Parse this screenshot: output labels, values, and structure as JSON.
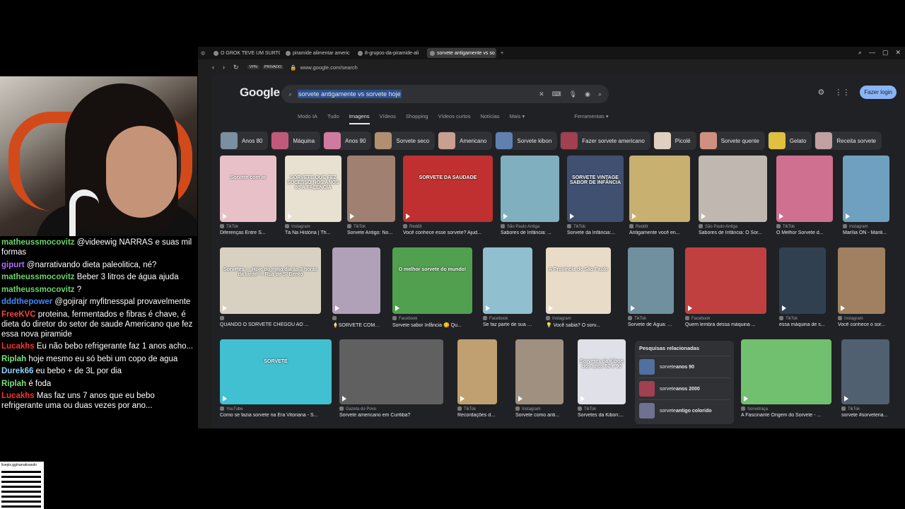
{
  "chat": {
    "messages": [
      {
        "user": "matheussmocovitz",
        "color": "#6ad46a",
        "text": "@videewig NARRAS e suas mil formas"
      },
      {
        "user": "gipurt",
        "color": "#b36bff",
        "text": "@narrativando dieta paleolitica, né?"
      },
      {
        "user": "matheussmocovitz",
        "color": "#6ad46a",
        "text": "Beber 3 litros de água ajuda"
      },
      {
        "user": "matheussmocovitz",
        "color": "#6ad46a",
        "text": "?"
      },
      {
        "user": "dddthepower",
        "color": "#3b8bff",
        "text": "@gojirajr myfitnesspal provavelmente"
      },
      {
        "user": "FreeKVC",
        "color": "#ff4040",
        "text": "proteina, fermentados e fibras é chave, é dieta do diretor do setor de saude Americano que fez essa nova piramide"
      },
      {
        "user": "Lucakhs",
        "color": "#ff3030",
        "text": "Eu não bebo refrigerante faz 1 anos acho..."
      },
      {
        "user": "Riplah",
        "color": "#7ee07e",
        "text": "hoje mesmo eu só bebi um copo de agua"
      },
      {
        "user": "Durek66",
        "color": "#8fd3ff",
        "text": "eu bebo + de 3L por dia"
      },
      {
        "user": "Riplah",
        "color": "#7ee07e",
        "text": "é foda"
      },
      {
        "user": "Lucakhs",
        "color": "#ff3030",
        "text": "Mas faz uns 7 anos que eu bebo refrigerante uma ou duas vezes por ano..."
      }
    ]
  },
  "qr": {
    "url": "livepix.gg/narrativando"
  },
  "browser": {
    "tabs": [
      {
        "label": "O GROK TEVE UM SURTO",
        "active": false
      },
      {
        "label": "piramide alimentar americ",
        "active": false
      },
      {
        "label": "8-grupos-da-piramide-ali",
        "active": false
      },
      {
        "label": "sorvete antigamente vs so",
        "active": true
      }
    ],
    "url": "www.google.com/search",
    "vpn": "VPN",
    "private": "PRIVADO"
  },
  "google": {
    "logo": "Google",
    "query": "sorvete antigamente vs sorvete hoje",
    "login": "Fazer login",
    "tabs": [
      "Modo IA",
      "Tudo",
      "Imagens",
      "Vídeos",
      "Shopping",
      "Vídeos curtos",
      "Notícias",
      "Mais ▾",
      "Ferramentas ▾"
    ],
    "chips": [
      {
        "label": "Anos 80",
        "color": "#7a8fa0"
      },
      {
        "label": "Máquina",
        "color": "#c05a7a"
      },
      {
        "label": "Anos 90",
        "color": "#d07aa0"
      },
      {
        "label": "Sorvete seco",
        "color": "#b09070"
      },
      {
        "label": "Americano",
        "color": "#c8a090"
      },
      {
        "label": "Sorvete kibon",
        "color": "#6080b0"
      },
      {
        "label": "Fazer sorvete americano",
        "color": "#a04050"
      },
      {
        "label": "Picolé",
        "color": "#e0d0c0"
      },
      {
        "label": "Sorvete quente",
        "color": "#d09080"
      },
      {
        "label": "Gelato",
        "color": "#e0c040"
      },
      {
        "label": "Receita sorvete",
        "color": "#c0a0a0"
      }
    ],
    "row1": [
      {
        "src": "TikTok",
        "title": "Diferenças Entre S...",
        "color": "#e8c0c8",
        "overlay": "Sorvete com ar"
      },
      {
        "src": "Instagram",
        "title": "Tá Na História | Th...",
        "color": "#e8e0d0",
        "overlay": "SORVETE QUE FEZ SUCESSO NOS ANOS 80 À FALÊNCIA"
      },
      {
        "src": "TikTok",
        "title": "Sorvete Antigo: No...",
        "color": "#a08070",
        "overlay": ""
      },
      {
        "src": "Reddit",
        "title": "Você conhece esse sorvete? Ajud...",
        "color": "#c03030",
        "overlay": "SORVETE DA SAUDADE"
      },
      {
        "src": "São Paulo Antiga",
        "title": "Sabores de Infância: ...",
        "color": "#80b0c0",
        "overlay": ""
      },
      {
        "src": "TikTok",
        "title": "Sorvete da Infância:...",
        "color": "#405070",
        "overlay": "SORVETE VINTAGE SABOR DE INFÂNCIA"
      },
      {
        "src": "Reddit",
        "title": "Antigamente você en...",
        "color": "#c8b070",
        "overlay": ""
      },
      {
        "src": "São Paulo Antiga",
        "title": "Sabores de Infância: O Sor...",
        "color": "#c0b8b0",
        "overlay": ""
      },
      {
        "src": "TikTok",
        "title": "O Melhor Sorvete d...",
        "color": "#d07090",
        "overlay": ""
      },
      {
        "src": "Instagram",
        "title": "Marília ON - Marili...",
        "color": "#70a0c0",
        "overlay": ""
      }
    ],
    "row2": [
      {
        "src": "",
        "title": "QUANDO O SORVETE CHEGOU AO ...",
        "color": "#d8d0c0",
        "overlay": "Sorvetes — Hoje do meio dia às 3 horas da tarde — Rua de S. Bento"
      },
      {
        "src": "",
        "title": "🍦SORVETE COM ...",
        "color": "#b0a0b8",
        "overlay": ""
      },
      {
        "src": "Facebook",
        "title": "Sorvete sabor Infância 😋 Qu...",
        "color": "#50a050",
        "overlay": "O melhor sorvete do mundo!"
      },
      {
        "src": "Facebook",
        "title": "Se faz parte de sua i...",
        "color": "#90c0d0",
        "overlay": ""
      },
      {
        "src": "Instagram",
        "title": "💡 Você sabia? O sorv...",
        "color": "#e8dcc8",
        "overlay": "A Província de São Paulo"
      },
      {
        "src": "TikTok",
        "title": "Sorvete de Água: N...",
        "color": "#7090a0",
        "overlay": ""
      },
      {
        "src": "Facebook",
        "title": "Quem lembra dessa máquina ...",
        "color": "#c04040",
        "overlay": ""
      },
      {
        "src": "TikTok",
        "title": "essa máquina de s...",
        "color": "#304050",
        "overlay": ""
      },
      {
        "src": "Instagram",
        "title": "Você conhece o sor...",
        "color": "#a08060",
        "overlay": ""
      }
    ],
    "row3": [
      {
        "src": "YouTube",
        "title": "Como se fazia sorvete na Era Vitoriana - S...",
        "color": "#40c0d0",
        "overlay": "SORVETE"
      },
      {
        "src": "Gazeta do Povo",
        "title": "Sorvete americano em Curitiba?",
        "color": "#606060",
        "overlay": ""
      },
      {
        "src": "TikTok",
        "title": "Recordações de S...",
        "color": "#c0a070",
        "overlay": ""
      },
      {
        "src": "Instagram",
        "title": "Sorvete como anti...",
        "color": "#a09080",
        "overlay": ""
      },
      {
        "src": "TikTok",
        "title": "Sorvetes da Kibon:...",
        "color": "#e0e0e8",
        "overlay": "Sorvetes da Kibon dos anos 80 e 90"
      },
      {
        "src": "Sorvetraça",
        "title": "A Fascinante Origem do Sorvete - ...",
        "color": "#70c070",
        "overlay": ""
      },
      {
        "src": "TikTok",
        "title": "sorvete #sorveteria...",
        "color": "#506070",
        "overlay": ""
      }
    ],
    "related": {
      "heading": "Pesquisas relacionadas",
      "items": [
        {
          "prefix": "sorvete ",
          "bold": "anos 90",
          "color": "#5070a0"
        },
        {
          "prefix": "sorvete ",
          "bold": "anos 2000",
          "color": "#a04050"
        },
        {
          "prefix": "sorvete ",
          "bold": "antigo colorido",
          "color": "#707090"
        }
      ]
    }
  }
}
